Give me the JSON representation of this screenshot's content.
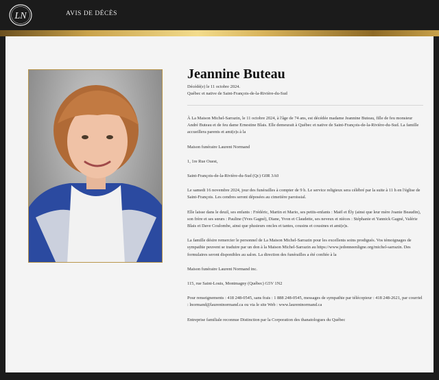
{
  "header": {
    "logo_text": "LN",
    "title": "AVIS DE DÉCÈS"
  },
  "colors": {
    "background": "#1b1b1b",
    "panel": "#f4f4f4",
    "gold": "#c9a24a"
  },
  "obituary": {
    "name": "Jeannine Buteau",
    "death_date": "Décédé(e) le 11 octobre 2024.",
    "origin": "Québec et native de Saint-François-de-la-Rivière-du-Sud",
    "paragraphs": [
      "À La Maison Michel-Sarrazin, le 11 octobre 2024, à l'âge de 74 ans, est décédée madame Jeannine Buteau, fille de feu monsieur André Buteau et de feu dame Ernestine Blais. Elle demeurait à Québec et native de Saint-François-de-la-Rivière-du-Sud. La famille accueillera parents et ami(e)s à la",
      "Maison funéraire Laurent Normand",
      "1, 1re Rue Ouest,",
      "Saint-François-de-la-Rivière-du-Sud (Qc) G0R 3A0",
      "Le samedi 16 novembre 2024, jour des funérailles à compter de 9 h. Le service religieux sera célébré par la suite à 11 h en l'église de Saint-François. Les cendres seront déposées au cimetière paroissial.",
      "Elle laisse dans le deuil, ses enfants : Frédéric, Martin et Mario, ses petits-enfants : Maël et Ély (ainsi que leur mère Joanie Beaudin), son frère et ses sœurs : Pauline (Yves Gagné), Diane, Yvon et Claudette, ses neveux et nièces : Stéphanie et Yannick Gagné, Valérie Blais et Dave Coulombe, ainsi que plusieurs oncles et tantes, cousins et cousines et ami(e)s.",
      "La famille désire remercier le personnel de La Maison Michel-Sarrazin pour les excellents soins prodigués. Vos témoignages de sympathie peuvent se traduire par un don à la Maison Michel-Sarrazin au https://www.jedonneenligne.org/michel-sarrazin. Des formulaires seront disponibles au salon. La direction des funérailles a été confiée à la",
      "Maison funéraire Laurent Normand inc.",
      "115, rue Saint-Louis, Montmagny (Québec) G5V 1N2",
      "Pour renseignements : 418 248-0545, sans frais : 1 888 248-0545, messages de sympathie par télécopieur : 418 248-2621, par courriel : lnormand@laurentnormand.ca ou via le site Web : www.laurentnormand.ca",
      "Entreprise familiale reconnue Distinction par la Corporation des thanatologues du Québec"
    ]
  }
}
